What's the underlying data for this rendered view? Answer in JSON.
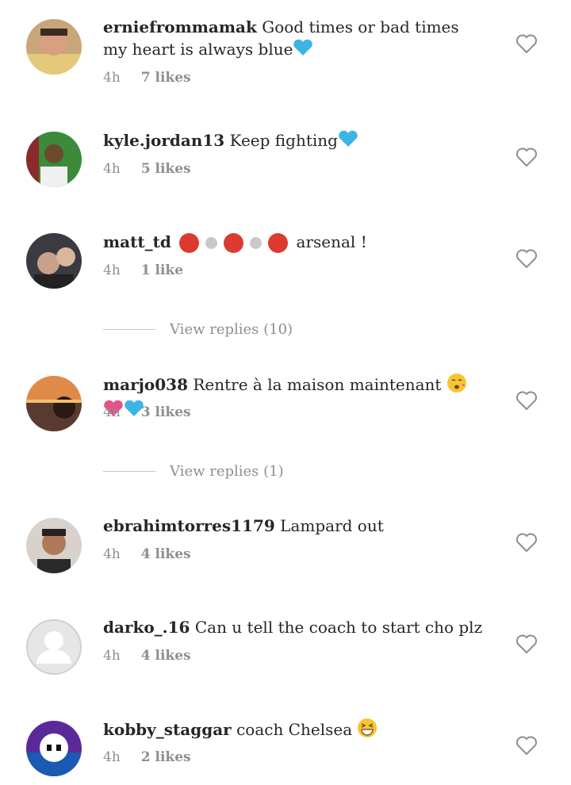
{
  "comments": [
    {
      "username": "erniefrommamak",
      "text": "Good times or bad times my heart is always blue",
      "time": "4h",
      "likes": "7 likes",
      "emoji": [
        "blue-heart"
      ]
    },
    {
      "username": "kyle.jordan13",
      "text": "Keep fighting",
      "time": "4h",
      "likes": "5 likes",
      "emoji": [
        "blue-heart"
      ]
    },
    {
      "username": "matt_td",
      "text": "arsenal !",
      "time": "4h",
      "likes": "1 like",
      "emoji": [
        "red-circle",
        "white-circle",
        "red-circle",
        "white-circle",
        "red-circle"
      ]
    },
    {
      "username": "marjo038",
      "text": "Rentre à la maison maintenant",
      "time": "4h",
      "likes": "3 likes",
      "emoji": [
        "face-blowing-kiss",
        "pink-heart",
        "blue-heart"
      ]
    },
    {
      "username": "ebrahimtorres1179",
      "text": "Lampard out",
      "time": "4h",
      "likes": "4 likes"
    },
    {
      "username": "darko_.16",
      "text": "Can u tell the coach to start cho plz",
      "time": "4h",
      "likes": "4 likes"
    },
    {
      "username": "kobby_staggar",
      "text": "coach Chelsea",
      "time": "4h",
      "likes": "2 likes",
      "emoji": [
        "grinning-squinting-face"
      ]
    }
  ],
  "replies": [
    {
      "label": "View replies (10)"
    },
    {
      "label": "View replies (1)"
    }
  ],
  "colors": {
    "text": "#262626",
    "meta": "#8e8e8e",
    "blue_heart": "#3cb4e6",
    "pink_heart": "#e8508a",
    "red_circle": "#dd3a32",
    "white_circle": "#c8c8c8"
  }
}
